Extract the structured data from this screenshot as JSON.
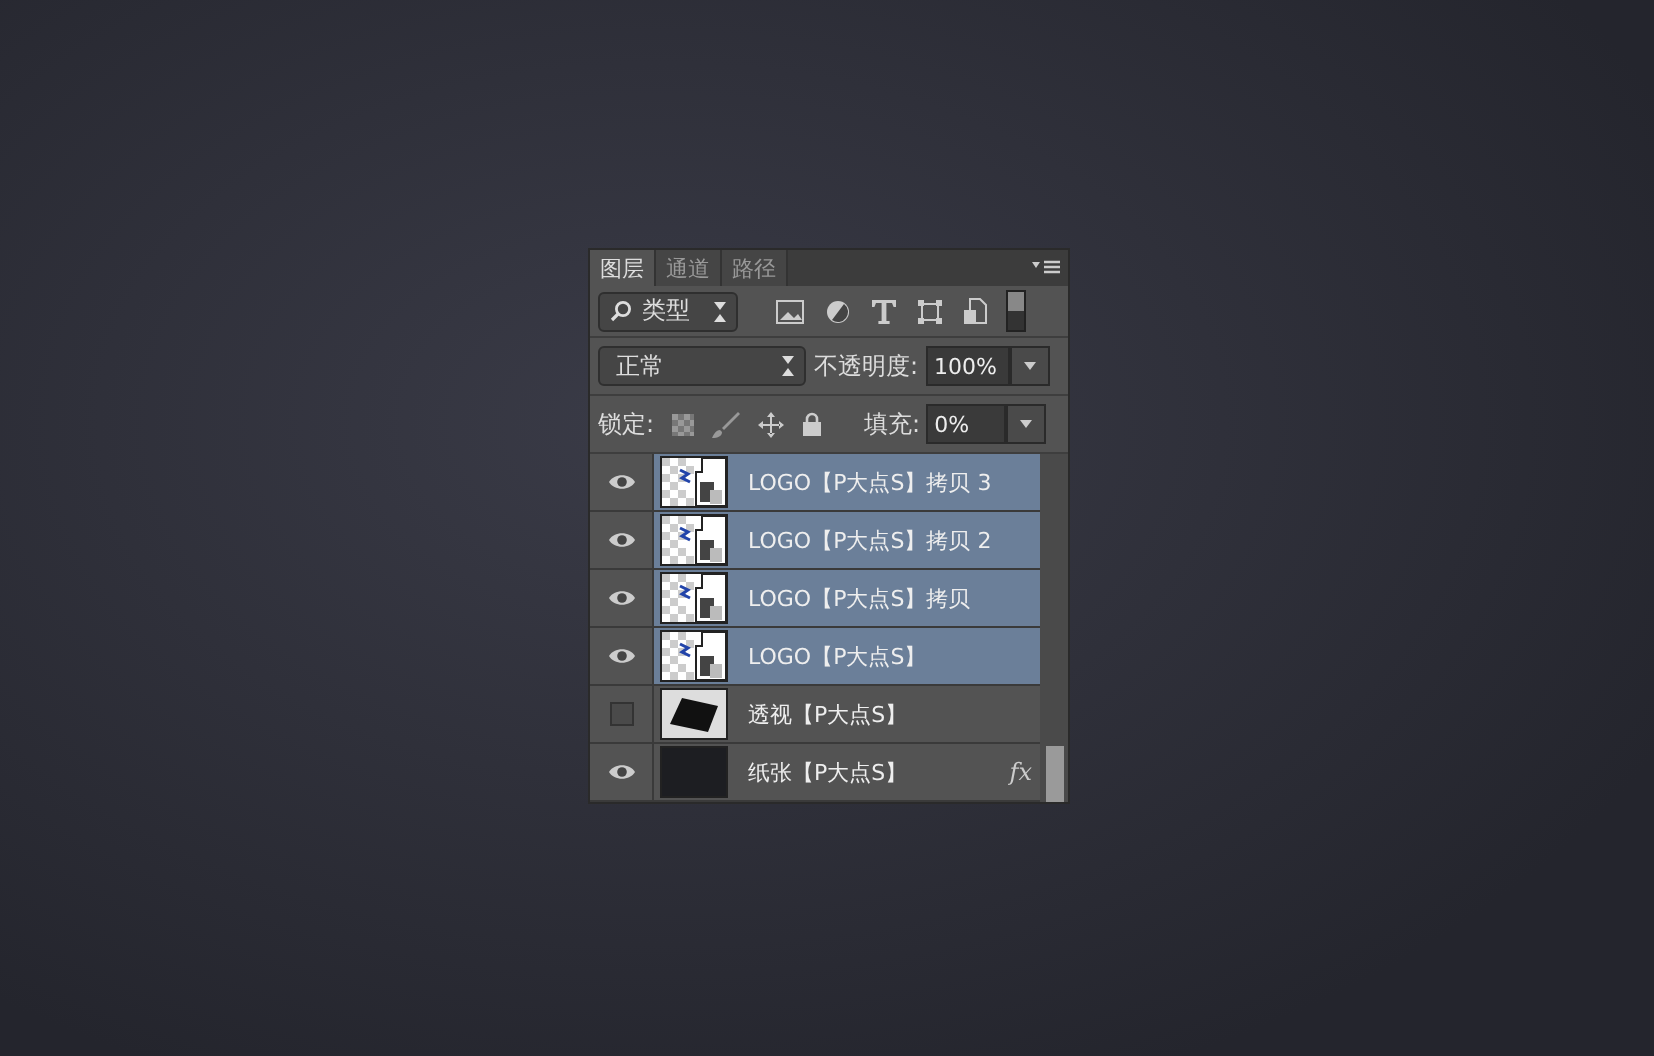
{
  "tabs": [
    {
      "label": "图层",
      "selected": true
    },
    {
      "label": "通道",
      "selected": false
    },
    {
      "label": "路径",
      "selected": false
    }
  ],
  "filter": {
    "label": "类型"
  },
  "blend": {
    "mode": "正常",
    "opacity_label": "不透明度:",
    "opacity": "100%"
  },
  "lock": {
    "label": "锁定:",
    "fill_label": "填充:",
    "fill": "0%"
  },
  "layers": [
    {
      "name": "LOGO【P大点S】拷贝 3",
      "kind": "logo",
      "visible": true,
      "selected": true
    },
    {
      "name": "LOGO【P大点S】拷贝 2",
      "kind": "logo",
      "visible": true,
      "selected": true
    },
    {
      "name": "LOGO【P大点S】拷贝",
      "kind": "logo",
      "visible": true,
      "selected": true
    },
    {
      "name": "LOGO【P大点S】",
      "kind": "logo",
      "visible": true,
      "selected": true
    },
    {
      "name": "透视【P大点S】",
      "kind": "shape",
      "visible": false,
      "selected": false
    },
    {
      "name": "纸张【P大点S】",
      "kind": "paper",
      "visible": true,
      "selected": false,
      "fx": "fx"
    }
  ]
}
